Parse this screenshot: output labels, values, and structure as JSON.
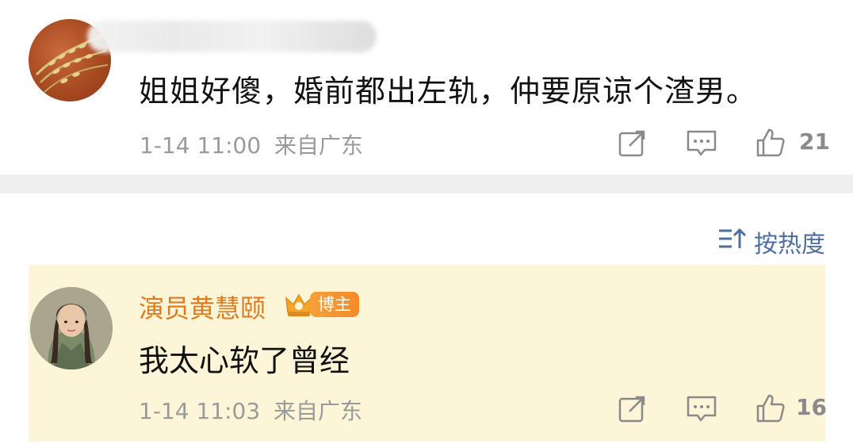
{
  "comment1": {
    "text": "姐姐好傻，婚前都出左轨，仲要原谅个渣男。",
    "timestamp": "1-14 11:00",
    "location": "来自广东",
    "like_count": "21",
    "icons": [
      "share-icon",
      "comment-icon",
      "like-icon"
    ]
  },
  "sort": {
    "label": "按热度"
  },
  "comment2": {
    "author": "演员黄慧颐",
    "badge": "博主",
    "text": "我太心软了曾经",
    "timestamp": "1-14 11:03",
    "location": "来自广东",
    "like_count": "16",
    "icons": [
      "share-icon",
      "comment-icon",
      "like-icon"
    ]
  },
  "colors": {
    "author_name": "#e07a1f",
    "highlight_background": "#fdf5d7",
    "sort_accent": "#4f6fa0",
    "meta_text": "#9a9a9a"
  }
}
